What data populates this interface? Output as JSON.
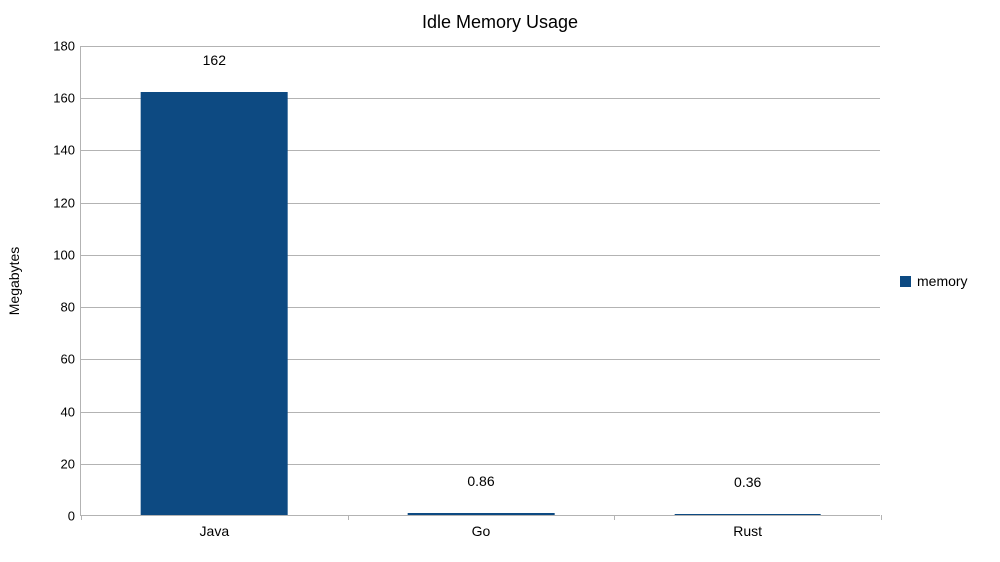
{
  "chart_data": {
    "type": "bar",
    "title": "Idle Memory Usage",
    "xlabel": "",
    "ylabel": "Megabytes",
    "ylim": [
      0,
      180
    ],
    "yticks": [
      0,
      20,
      40,
      60,
      80,
      100,
      120,
      140,
      160,
      180
    ],
    "categories": [
      "Java",
      "Go",
      "Rust"
    ],
    "series": [
      {
        "name": "memory",
        "values": [
          162,
          0.86,
          0.36
        ],
        "color": "#0d4a82"
      }
    ],
    "data_labels": [
      "162",
      "0.86",
      "0.36"
    ]
  }
}
